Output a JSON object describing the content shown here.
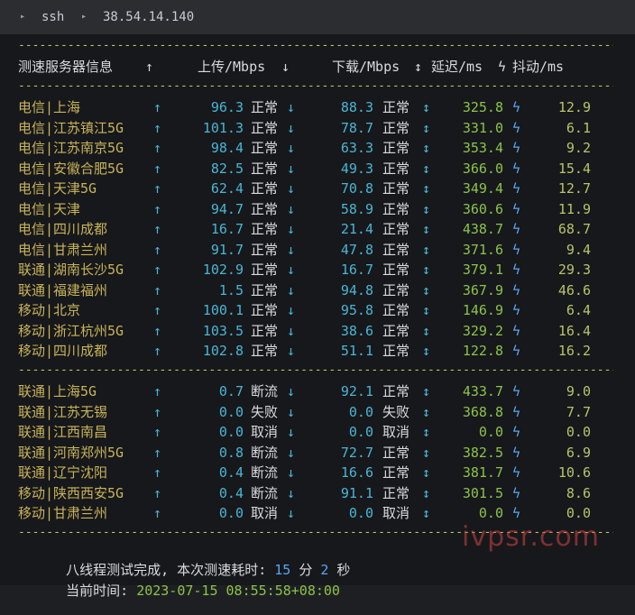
{
  "titlebar": {
    "app": "ssh",
    "host": "38.54.14.140"
  },
  "separator": "---------------------------------------------------------------------------------------------------------",
  "header": {
    "server": "测速服务器信息",
    "upload": "上传/Mbps",
    "download": "下载/Mbps",
    "latency": "延迟/ms",
    "jitter": "抖动/ms",
    "up_arrow": "↑",
    "down_arrow": "↓",
    "updown_arrow": "↕",
    "bolt": "ϟ"
  },
  "group1": [
    {
      "server": "电信|上海",
      "up": "96.3",
      "up_status": "正常",
      "down": "88.3",
      "down_status": "正常",
      "latency": "325.8",
      "jitter": "12.9"
    },
    {
      "server": "电信|江苏镇江5G",
      "up": "101.3",
      "up_status": "正常",
      "down": "78.7",
      "down_status": "正常",
      "latency": "331.0",
      "jitter": "6.1"
    },
    {
      "server": "电信|江苏南京5G",
      "up": "98.4",
      "up_status": "正常",
      "down": "63.3",
      "down_status": "正常",
      "latency": "353.4",
      "jitter": "9.2"
    },
    {
      "server": "电信|安徽合肥5G",
      "up": "82.5",
      "up_status": "正常",
      "down": "49.3",
      "down_status": "正常",
      "latency": "366.0",
      "jitter": "15.4"
    },
    {
      "server": "电信|天津5G",
      "up": "62.4",
      "up_status": "正常",
      "down": "70.8",
      "down_status": "正常",
      "latency": "349.4",
      "jitter": "12.7"
    },
    {
      "server": "电信|天津",
      "up": "94.7",
      "up_status": "正常",
      "down": "58.9",
      "down_status": "正常",
      "latency": "360.6",
      "jitter": "11.9"
    },
    {
      "server": "电信|四川成都",
      "up": "16.7",
      "up_status": "正常",
      "down": "21.4",
      "down_status": "正常",
      "latency": "438.7",
      "jitter": "68.7"
    },
    {
      "server": "电信|甘肃兰州",
      "up": "91.7",
      "up_status": "正常",
      "down": "47.8",
      "down_status": "正常",
      "latency": "371.6",
      "jitter": "9.4"
    },
    {
      "server": "联通|湖南长沙5G",
      "up": "102.9",
      "up_status": "正常",
      "down": "16.7",
      "down_status": "正常",
      "latency": "379.1",
      "jitter": "29.3"
    },
    {
      "server": "联通|福建福州",
      "up": "1.5",
      "up_status": "正常",
      "down": "94.8",
      "down_status": "正常",
      "latency": "367.9",
      "jitter": "46.6"
    },
    {
      "server": "移动|北京",
      "up": "100.1",
      "up_status": "正常",
      "down": "95.8",
      "down_status": "正常",
      "latency": "146.9",
      "jitter": "6.4"
    },
    {
      "server": "移动|浙江杭州5G",
      "up": "103.5",
      "up_status": "正常",
      "down": "38.6",
      "down_status": "正常",
      "latency": "329.2",
      "jitter": "16.4"
    },
    {
      "server": "移动|四川成都",
      "up": "102.8",
      "up_status": "正常",
      "down": "51.1",
      "down_status": "正常",
      "latency": "122.8",
      "jitter": "16.2"
    }
  ],
  "group2": [
    {
      "server": "联通|上海5G",
      "up": "0.7",
      "up_status": "断流",
      "down": "92.1",
      "down_status": "正常",
      "latency": "433.7",
      "jitter": "9.0"
    },
    {
      "server": "联通|江苏无锡",
      "up": "0.0",
      "up_status": "失败",
      "down": "0.0",
      "down_status": "失败",
      "latency": "368.8",
      "jitter": "7.7"
    },
    {
      "server": "联通|江西南昌",
      "up": "0.0",
      "up_status": "取消",
      "down": "0.0",
      "down_status": "取消",
      "latency": "0.0",
      "jitter": "0.0"
    },
    {
      "server": "联通|河南郑州5G",
      "up": "0.8",
      "up_status": "断流",
      "down": "72.7",
      "down_status": "正常",
      "latency": "382.5",
      "jitter": "6.9"
    },
    {
      "server": "联通|辽宁沈阳",
      "up": "0.4",
      "up_status": "断流",
      "down": "16.6",
      "down_status": "正常",
      "latency": "381.7",
      "jitter": "10.6"
    },
    {
      "server": "移动|陕西西安5G",
      "up": "0.4",
      "up_status": "断流",
      "down": "91.1",
      "down_status": "正常",
      "latency": "301.5",
      "jitter": "8.6"
    },
    {
      "server": "移动|甘肃兰州",
      "up": "0.0",
      "up_status": "取消",
      "down": "0.0",
      "down_status": "取消",
      "latency": "0.0",
      "jitter": "0.0"
    }
  ],
  "footer": {
    "done_prefix": "八线程测试完成, 本次测速耗时: ",
    "minutes": "15",
    "min_unit": " 分 ",
    "seconds": "2",
    "sec_unit": " 秒",
    "time_label": "当前时间: ",
    "time_value": "2023-07-15 08:55:58+08:00"
  },
  "watermark": "ivpsr.com",
  "colors": {
    "server_name": "#c8b45a",
    "arrow": "#49b6d6",
    "value": "#49b6d6",
    "status": "#d8dadd",
    "latency": "#8cc34a",
    "bolt": "#58a6f0",
    "jitter": "#b9c46a",
    "separator": "#b9c46a"
  }
}
